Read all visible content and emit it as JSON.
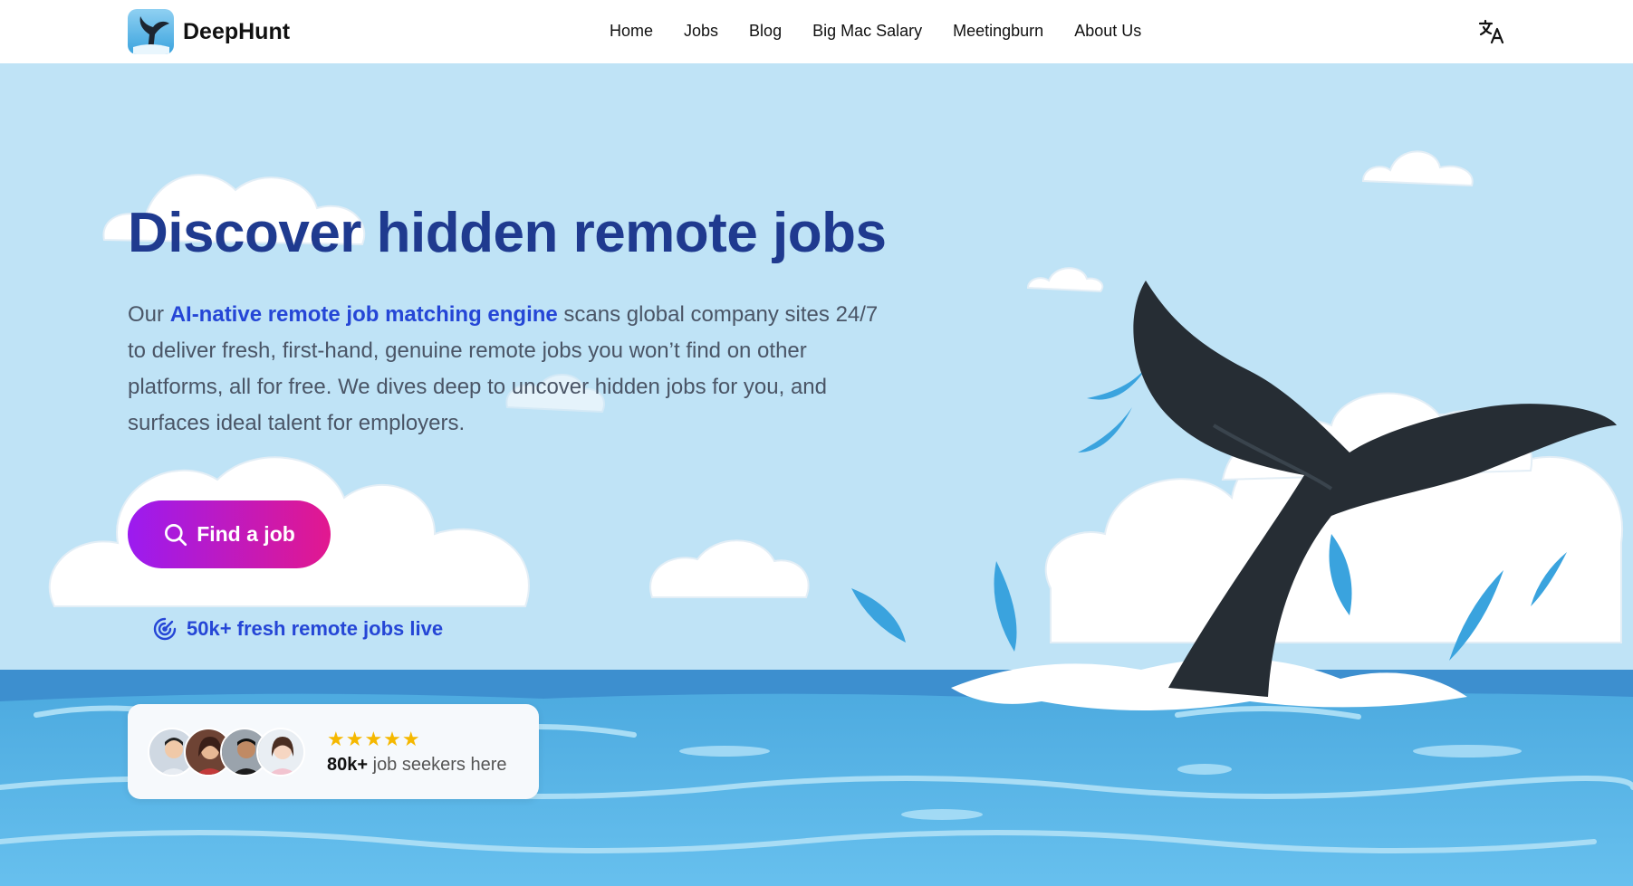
{
  "brand": {
    "name": "DeepHunt"
  },
  "nav": {
    "items": [
      "Home",
      "Jobs",
      "Blog",
      "Big Mac Salary",
      "Meetingburn",
      "About Us"
    ]
  },
  "lang_icon": "translate-icon",
  "hero": {
    "headline": "Discover hidden remote jobs",
    "desc_pre": "Our ",
    "desc_highlight": "AI-native remote job matching engine",
    "desc_post": " scans global company sites 24/7 to deliver fresh, first-hand, genuine remote jobs you won’t find on other platforms, all for free. We dives deep to uncover hidden jobs for you, and surfaces ideal talent for employers.",
    "cta_label": "Find a job",
    "live_text": "50k+ fresh remote jobs live"
  },
  "seekers": {
    "stars": "★★★★★",
    "count": "80k+",
    "label": " job seekers here"
  },
  "colors": {
    "headline": "#1f3a8f",
    "highlight": "#2546d6",
    "sky": "#bfe3f6",
    "sea": "#5bb5e6",
    "cta_start": "#9b1bf0",
    "cta_end": "#e2188f"
  }
}
